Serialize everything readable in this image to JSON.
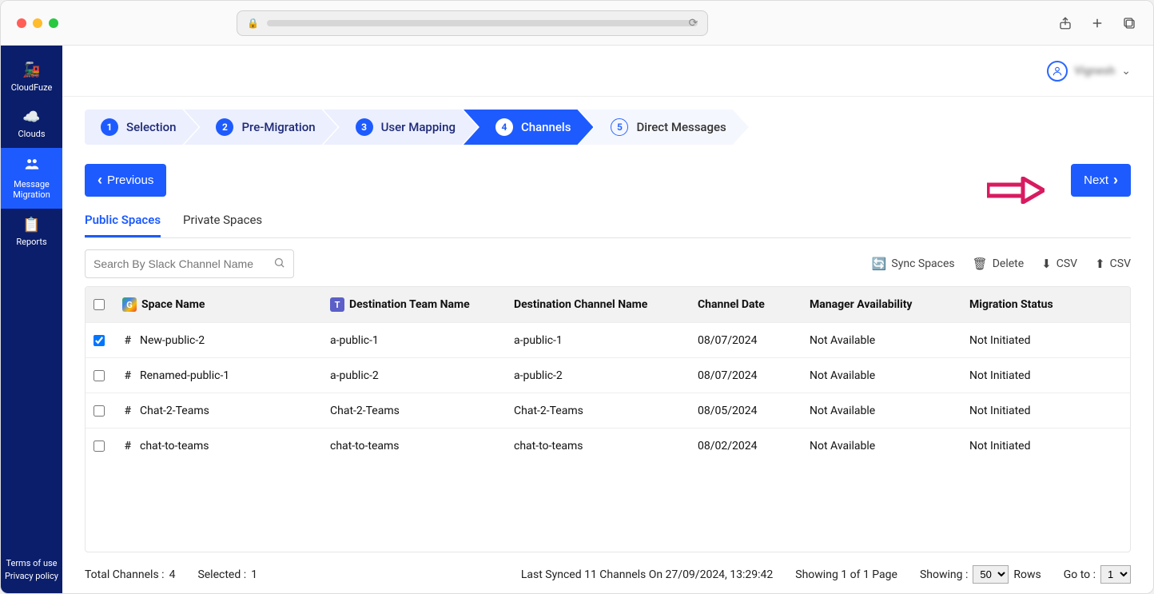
{
  "chrome": {
    "reload_tooltip": "Reload"
  },
  "sidebar": {
    "items": [
      {
        "label": "CloudFuze",
        "icon": "brand"
      },
      {
        "label": "Clouds",
        "icon": "cloud"
      },
      {
        "label": "Message\nMigration",
        "icon": "users"
      },
      {
        "label": "Reports",
        "icon": "clipboard"
      }
    ],
    "active_index": 2,
    "footer": {
      "terms": "Terms of use",
      "privacy": "Privacy policy"
    }
  },
  "user": {
    "name": "Vignesh"
  },
  "stepper": {
    "steps": [
      {
        "num": "1",
        "label": "Selection"
      },
      {
        "num": "2",
        "label": "Pre-Migration"
      },
      {
        "num": "3",
        "label": "User Mapping"
      },
      {
        "num": "4",
        "label": "Channels"
      },
      {
        "num": "5",
        "label": "Direct Messages"
      }
    ],
    "active_index": 3
  },
  "buttons": {
    "prev": "Previous",
    "next": "Next"
  },
  "tabs": {
    "public": "Public Spaces",
    "private": "Private Spaces",
    "active": "public"
  },
  "search": {
    "placeholder": "Search By Slack Channel Name"
  },
  "toolbar": {
    "sync": "Sync Spaces",
    "delete": "Delete",
    "csv_down": "CSV",
    "csv_up": "CSV"
  },
  "table": {
    "headers": {
      "space": "Space Name",
      "team": "Destination Team Name",
      "channel": "Destination Channel Name",
      "date": "Channel Date",
      "manager": "Manager Availability",
      "status": "Migration Status"
    },
    "rows": [
      {
        "checked": true,
        "space": "New-public-2",
        "team": "a-public-1",
        "channel": "a-public-1",
        "date": "08/07/2024",
        "manager": "Not Available",
        "status": "Not Initiated"
      },
      {
        "checked": false,
        "space": "Renamed-public-1",
        "team": "a-public-2",
        "channel": "a-public-2",
        "date": "08/07/2024",
        "manager": "Not Available",
        "status": "Not Initiated"
      },
      {
        "checked": false,
        "space": "Chat-2-Teams",
        "team": "Chat-2-Teams",
        "channel": "Chat-2-Teams",
        "date": "08/05/2024",
        "manager": "Not Available",
        "status": "Not Initiated"
      },
      {
        "checked": false,
        "space": "chat-to-teams",
        "team": "chat-to-teams",
        "channel": "chat-to-teams",
        "date": "08/02/2024",
        "manager": "Not Available",
        "status": "Not Initiated"
      }
    ]
  },
  "footer": {
    "total_label": "Total Channels :",
    "total_value": "4",
    "selected_label": "Selected :",
    "selected_value": "1",
    "last_sync": "Last Synced 11 Channels On 27/09/2024, 13:29:42",
    "showing_page": "Showing 1 of 1 Page",
    "showing_label": "Showing :",
    "page_size": "50",
    "rows_label": "Rows",
    "goto_label": "Go to :",
    "goto_value": "1"
  }
}
